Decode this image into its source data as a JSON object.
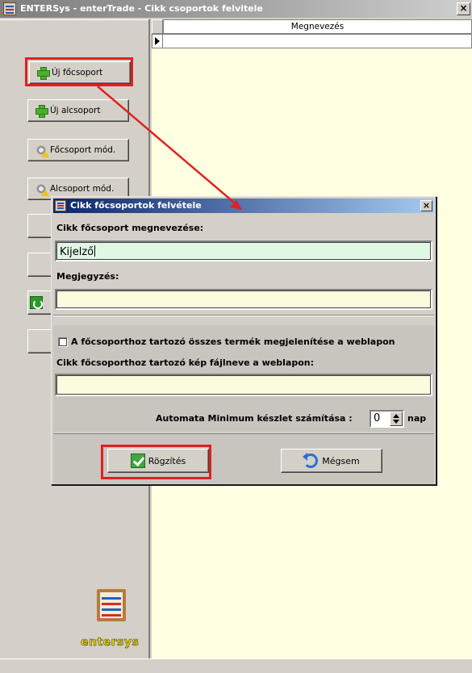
{
  "window": {
    "title": "ENTERSys - enterTrade - Cikk csoportok felvitele",
    "close_label": "×"
  },
  "sidebar": {
    "buttons": [
      {
        "label": "Új főcsoport",
        "icon": "plus-icon"
      },
      {
        "label": "Új alcsoport",
        "icon": "plus-icon"
      },
      {
        "label": "Főcsoport mód.",
        "icon": "gear-icon"
      },
      {
        "label": "Alcsoport mód.",
        "icon": "gear-icon"
      }
    ],
    "logo_text": "entersys"
  },
  "grid": {
    "column_header": "Megnevezés"
  },
  "dialog": {
    "title": "Cikk főcsoportok felvétele",
    "close_label": "×",
    "name_label": "Cikk főcsoport megnevezése:",
    "name_value": "Kijelző",
    "note_label": "Megjegyzés:",
    "note_value": "",
    "web_show_all_label": "A főcsoporthoz tartozó összes termék megjelenítése a weblapon",
    "web_show_all_checked": false,
    "image_filename_label": "Cikk főcsoporthoz tartozó kép fájlneve a weblapon:",
    "image_filename_value": "",
    "auto_min_label": "Automata Minimum készlet számítása :",
    "auto_min_value": "0",
    "auto_min_unit": "nap",
    "save_button": "Rögzítés",
    "cancel_button": "Mégsem"
  },
  "colors": {
    "annotation": "#e02020",
    "name_field_bg": "#e0f7e4",
    "note_field_bg": "#fbfbde",
    "grid_bg": "#ffffe1"
  }
}
